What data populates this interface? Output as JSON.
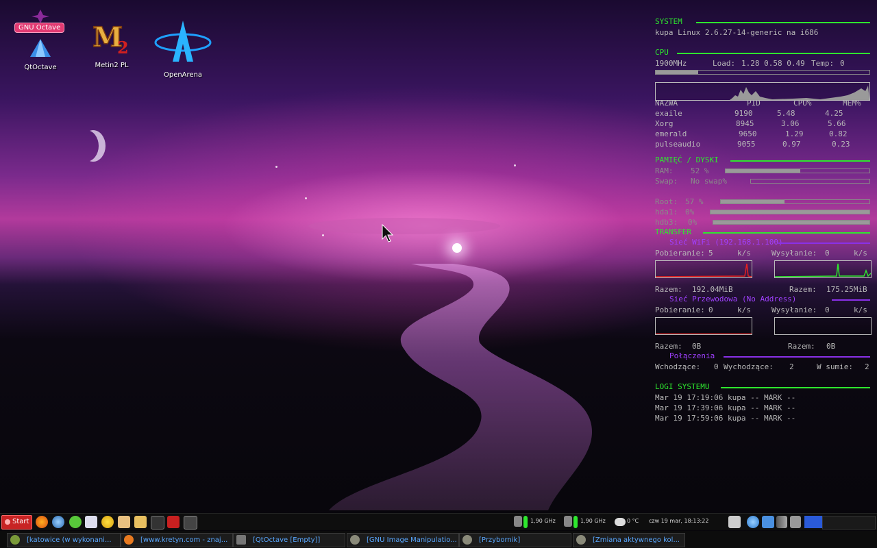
{
  "desktop_icons": [
    {
      "label": "QtOctave"
    },
    {
      "label": "Metin2 PL"
    },
    {
      "label": "OpenArena"
    }
  ],
  "octave_tag": "GNU Octave",
  "system": {
    "title": "SYSTEM",
    "host": "kupa Linux 2.6.27-14-generic na i686"
  },
  "cpu": {
    "title": "CPU",
    "freq": "1900MHz",
    "load_label": "Load:",
    "load": "1.28  0.58  0.49",
    "temp_label": "Temp:",
    "temp": "0",
    "usage_fraction": 0.2,
    "headers": {
      "name": "NAZWA",
      "pid": "PID",
      "cpu": "CPU%",
      "mem": "MEM%"
    },
    "processes": [
      {
        "name": "exaile",
        "pid": "9190",
        "cpu": "5.48",
        "mem": "4.25"
      },
      {
        "name": "Xorg",
        "pid": "8945",
        "cpu": "3.06",
        "mem": "5.66"
      },
      {
        "name": "emerald",
        "pid": "9650",
        "cpu": "1.29",
        "mem": "0.82"
      },
      {
        "name": "pulseaudio",
        "pid": "9055",
        "cpu": "0.97",
        "mem": "0.23"
      }
    ]
  },
  "memory": {
    "title": "PAMIĘĆ / DYSKI",
    "ram_label": "RAM:",
    "ram": "52 %",
    "ram_fraction": 0.52,
    "swap_label": "Swap:",
    "swap": "No swap%",
    "swap_fraction": 0,
    "root_label": "Root:",
    "root": "57 %",
    "root_fraction": 0.43,
    "hda1_label": "hda1:",
    "hda1": "0%",
    "hda1_fraction": 1,
    "hdb3_label": "hdb3:",
    "hdb3": "0%",
    "hdb3_fraction": 1
  },
  "transfer": {
    "title": "TRANSFER",
    "wifi_title": "Sieć WiFi (192.168.1.100)",
    "down_label": "Pobieranie:",
    "up_label": "Wysyłanie:",
    "unit": "k/s",
    "wifi_down": "5",
    "wifi_up": "0",
    "total_label": "Razem:",
    "wifi_down_total": "192.04MiB",
    "wifi_up_total": "175.25MiB",
    "wired_title": "Sieć Przewodowa (No Address)",
    "wired_down": "0",
    "wired_up": "0",
    "wired_down_total": "0B",
    "wired_up_total": "0B",
    "conn_title": "Połączenia",
    "in_label": "Wchodzące:",
    "in": "0",
    "out_label": "Wychodzące:",
    "out": "2",
    "sum_label": "W sumie:",
    "sum": "2"
  },
  "logs": {
    "title": "LOGI SYSTEMU",
    "lines": [
      "Mar 19 17:19:06 kupa -- MARK --",
      "Mar 19 17:39:06 kupa -- MARK --",
      "Mar 19 17:59:06 kupa -- MARK --"
    ]
  },
  "taskbar": {
    "start": "Start",
    "cpu1_freq": "1,90 GHz",
    "cpu2_freq": "1,90 GHz",
    "weather": "0 °C",
    "clock": "czw 19 mar, 18:13:22",
    "tasks": [
      "[katowice (w wykonani...",
      "[www.kretyn.com - znaj...",
      "[QtOctave [Empty]]",
      "[GNU Image Manipulatio...",
      "[Przybornik]",
      "[Zmiana aktywnego kol..."
    ]
  },
  "colors": {
    "section_title": "#2ee82e",
    "subsection_title": "#a040ff",
    "task_text": "#5aa8ff",
    "start_button": "#c82424"
  }
}
